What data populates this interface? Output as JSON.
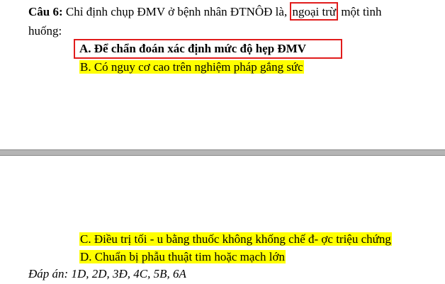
{
  "question": {
    "label": "Câu 6:",
    "text_before": " Chỉ định chụp ĐMV ở bệnh nhân ĐTNÔĐ là, ",
    "highlight": "ngoại trừ",
    "text_after": " một tình",
    "text_line2": "huống:"
  },
  "options": {
    "a": "A. Để chẩn đoán xác định mức độ hẹp ĐMV",
    "b": "B.  Có nguy cơ cao trên nghiệm pháp gắng sức",
    "c": "C.  Điều trị tối - u bằng thuốc không khống chế đ- ợc triệu chứng",
    "d": "D.  Chuẩn bị phẫu thuật tim hoặc mạch lớn"
  },
  "answer": "Đáp án: 1D, 2D, 3Đ, 4C, 5B, 6A",
  "colors": {
    "highlight": "#ffff00",
    "box_border": "#e11c1c",
    "divider": "#b4b4b4"
  }
}
